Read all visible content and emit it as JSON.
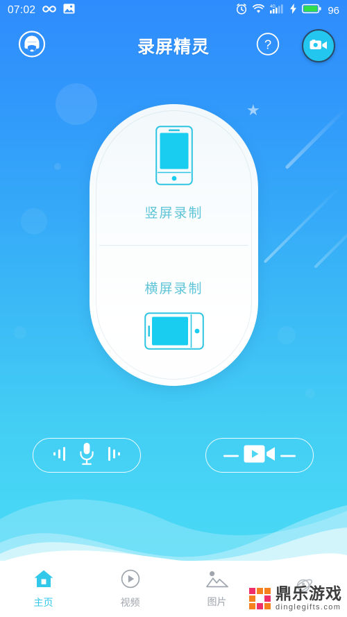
{
  "status_bar": {
    "time": "07:02",
    "left_icons": [
      "infinity-icon",
      "screenshot-image-icon"
    ],
    "right_icons": [
      "alarm-clock-icon",
      "wifi-icon",
      "signal-4g-icon",
      "charging-bolt-icon",
      "battery-icon"
    ],
    "network_label": "4G",
    "battery_percent": "96",
    "battery_color": "#31dd4a"
  },
  "header": {
    "title": "录屏精灵",
    "avatar_icon": "user-headphones-icon",
    "help_icon": "question-mark-icon",
    "record_button_icon": "video-camera-icon",
    "record_button_color": "#23c6ef"
  },
  "mode_card": {
    "portrait": {
      "label": "竖屏录制",
      "icon": "portrait-phone-icon"
    },
    "landscape": {
      "label": "横屏录制",
      "icon": "landscape-phone-icon"
    },
    "label_color": "#5ec4d7",
    "screen_fill": "#18cdf0"
  },
  "actions": [
    {
      "name": "audio-record",
      "icon": "microphone-icon"
    },
    {
      "name": "video-record",
      "icon": "video-play-camera-icon"
    }
  ],
  "bottom_nav": {
    "active_color": "#32c8ea",
    "inactive_color": "#9fa6ad",
    "items": [
      {
        "label": "主页",
        "icon": "home-icon",
        "active": true
      },
      {
        "label": "视频",
        "icon": "play-circle-icon",
        "active": false
      },
      {
        "label": "图片",
        "icon": "image-mountain-icon",
        "active": false
      },
      {
        "label": "",
        "icon": "planet-rocket-icon",
        "active": false
      }
    ]
  },
  "watermark": {
    "title": "鼎乐游戏",
    "subtitle": "dinglegifts.com",
    "colors": [
      "#ef2f6a",
      "#f6821f"
    ]
  },
  "theme": {
    "bg_top": "#2f8cfc",
    "bg_bottom": "#49dbf6",
    "card_bg": "#ffffff"
  }
}
